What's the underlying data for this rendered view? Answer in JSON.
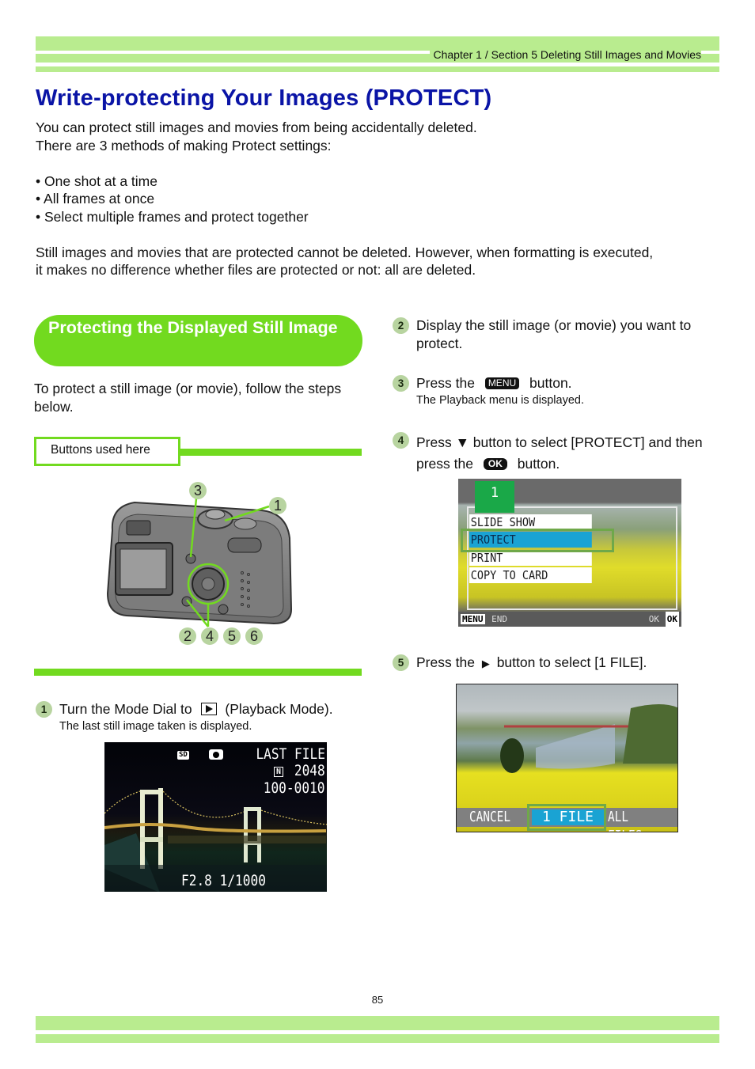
{
  "header": {
    "breadcrumb": "Chapter  1 / Section 5  Deleting Still Images and Movies"
  },
  "page_title": "Write-protecting Your Images (PROTECT)",
  "intro": {
    "line1": "You can protect still images and movies from being accidentally deleted.",
    "line2": "There are 3 methods of making Protect settings:",
    "methods": [
      "• One shot at a time",
      "• All frames at once",
      "• Select multiple frames and protect together"
    ],
    "note_line1": "Still images and movies that are protected cannot be deleted. However,  when formatting is executed,",
    "note_line2": "it makes no difference whether files are protected or not: all are deleted."
  },
  "section": {
    "heading": "Protecting the Displayed Still Image",
    "lead": "To protect a still image (or movie), follow the steps below.",
    "buttons_used_label": "Buttons used here",
    "camera_callouts": [
      "3",
      "1",
      "2",
      "4",
      "5",
      "6"
    ]
  },
  "steps": [
    {
      "num": "1",
      "text_pre": "Turn the Mode Dial to",
      "icon": "playback-icon",
      "text_post": "(Playback Mode).",
      "sub": "The last still image taken is displayed."
    },
    {
      "num": "2",
      "text": "Display the still image (or movie) you want to protect."
    },
    {
      "num": "3",
      "text_pre": "Press the",
      "key": "MENU",
      "text_post": "button.",
      "sub": "The Playback menu is displayed."
    },
    {
      "num": "4",
      "text_pre": "Press ▼ button to select [PROTECT] and then press the",
      "key": "OK",
      "text_post": "button."
    },
    {
      "num": "5",
      "text_pre": "Press the",
      "arrow": "▶",
      "text_post": "button to select [1 FILE]."
    }
  ],
  "screen1": {
    "card_icon": "SD",
    "mode_icon": "camera-icon",
    "last_file": "LAST FILE",
    "quality": "N",
    "resolution": "2048",
    "file_no": "100-0010",
    "exposure": "F2.8 1/1000"
  },
  "screen2": {
    "tab": "1",
    "menu_items": [
      "SLIDE SHOW",
      "PROTECT",
      "PRINT",
      "COPY TO CARD"
    ],
    "selected_index": 1,
    "footer_left_key": "MENU",
    "footer_left_label": "END",
    "footer_right_label": "OK",
    "footer_right_key": "OK"
  },
  "screen3": {
    "options": [
      "CANCEL",
      "1 FILE",
      "ALL FILES"
    ],
    "selected_index": 1
  },
  "colors": {
    "title": "#0a14a6",
    "accent_green": "#72da1f",
    "band_green": "#b9ec8f",
    "step_badge": "#b8d4a0",
    "lcd_highlight": "#1aa3d3"
  },
  "footer": {
    "page_number": "85"
  }
}
